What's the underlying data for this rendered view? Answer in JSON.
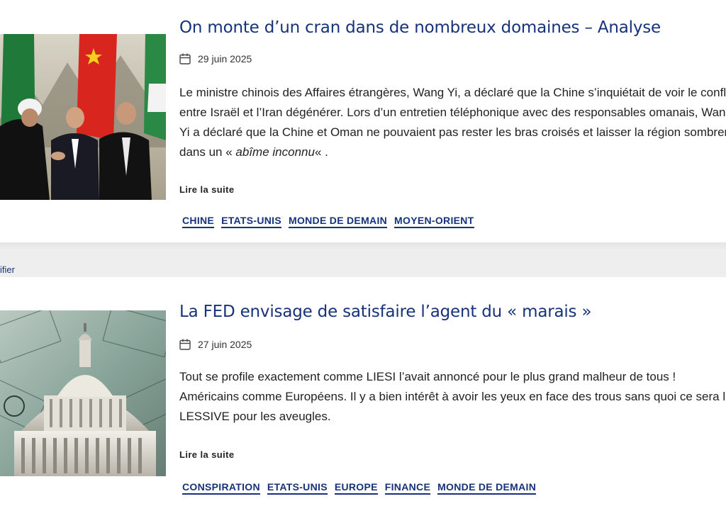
{
  "articles": [
    {
      "title": "On monte d’un cran dans de nombreux domaines – Analyse",
      "date": "29 juin 2025",
      "excerpt_before": "Le ministre chinois des Affaires étrangères, Wang Yi, a déclaré que la Chine s’inquiétait de voir le conflit entre Israël et l’Iran dégénérer. Lors d’un entretien téléphonique avec des responsables omanais, Wang Yi a déclaré que la Chine et Oman ne pouvaient pas rester les bras croisés et laisser la région sombrer dans un « ",
      "excerpt_emph": "abîme inconnu",
      "excerpt_after": "« .",
      "read_more": "Lire la suite",
      "tags": [
        "CHINE",
        "ETATS-UNIS",
        "MONDE DE DEMAIN",
        "MOYEN-ORIENT"
      ]
    },
    {
      "title": "La FED envisage de satisfaire l’agent du « marais »",
      "date": "27 juin 2025",
      "excerpt": "Tout se profile exactement comme LIESI l’avait annoncé pour le plus grand malheur de tous ! Américains comme Européens. Il y a bien intérêt à avoir les yeux en face des trous sans quoi ce sera la LESSIVE pour les aveugles.",
      "read_more": "Lire la suite",
      "tags": [
        "CONSPIRATION",
        "ETATS-UNIS",
        "EUROPE",
        "FINANCE",
        "MONDE DE DEMAIN"
      ]
    }
  ],
  "band": {
    "partial_link": "ifier"
  },
  "colors": {
    "accent": "#16327a",
    "band": "#eeeeee"
  },
  "icons": {
    "date": "calendar-icon"
  }
}
